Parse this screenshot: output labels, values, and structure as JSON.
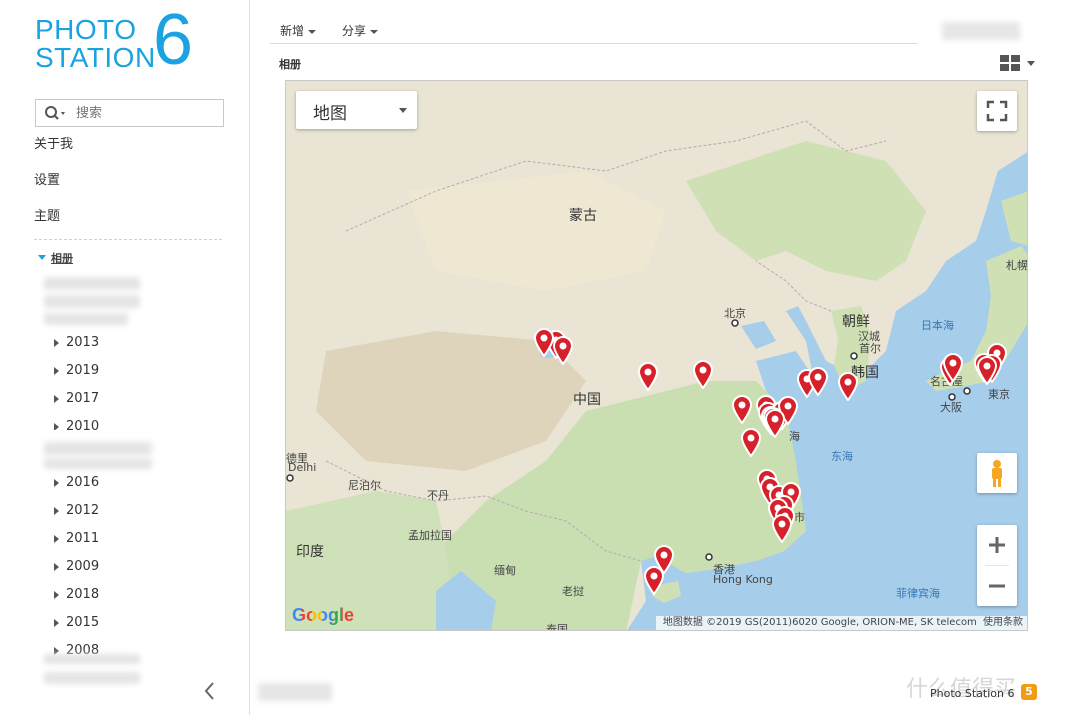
{
  "logo": {
    "line1": "PHOTO",
    "line2": "STATION",
    "number": "6"
  },
  "search": {
    "placeholder": "搜索"
  },
  "nav": {
    "about": "关于我",
    "settings": "设置",
    "theme": "主题"
  },
  "albums": {
    "title": "相册",
    "years": [
      "2013",
      "2019",
      "2017",
      "2010",
      "2016",
      "2012",
      "2011",
      "2009",
      "2018",
      "2015",
      "2008"
    ]
  },
  "toolbar": {
    "new_label": "新增",
    "share_label": "分享"
  },
  "section": {
    "title": "相册"
  },
  "map": {
    "type_label": "地图",
    "labels": {
      "mongolia": "蒙古",
      "beijing": "北京",
      "north_korea": "朝鲜",
      "hanseong": "汉城",
      "seoul": "首尔",
      "south_korea": "韩国",
      "japan_sea": "日本海",
      "sapporo": "札幌",
      "nagoya": "名古屋",
      "osaka": "大阪",
      "tokyo": "東京",
      "china": "中国",
      "east_sea": "东海",
      "new_delhi_1": "德里",
      "new_delhi_2": "Delhi",
      "nepal": "尼泊尔",
      "bhutan": "不丹",
      "bangladesh": "孟加拉国",
      "india": "印度",
      "myanmar": "缅甸",
      "laos": "老挝",
      "hongkong_cn": "香港",
      "hongkong_en": "Hong Kong",
      "philippine_sea": "菲律宾海",
      "taipei_frag": "市",
      "shanghai_frag": "海",
      "thailand_frag": "泰国"
    },
    "attribution": "地图数据 ©2019 GS(2011)6020 Google, ORION-ME, SK telecom",
    "terms": "使用条款",
    "google": "Google"
  },
  "footer": {
    "brand": "Photo Station 6",
    "badge": "5",
    "watermark": "什么值得买"
  },
  "colors": {
    "accent": "#1aa3e0",
    "pin": "#d6202a",
    "sea": "#a6cdea",
    "land": "#e9e4d3"
  }
}
